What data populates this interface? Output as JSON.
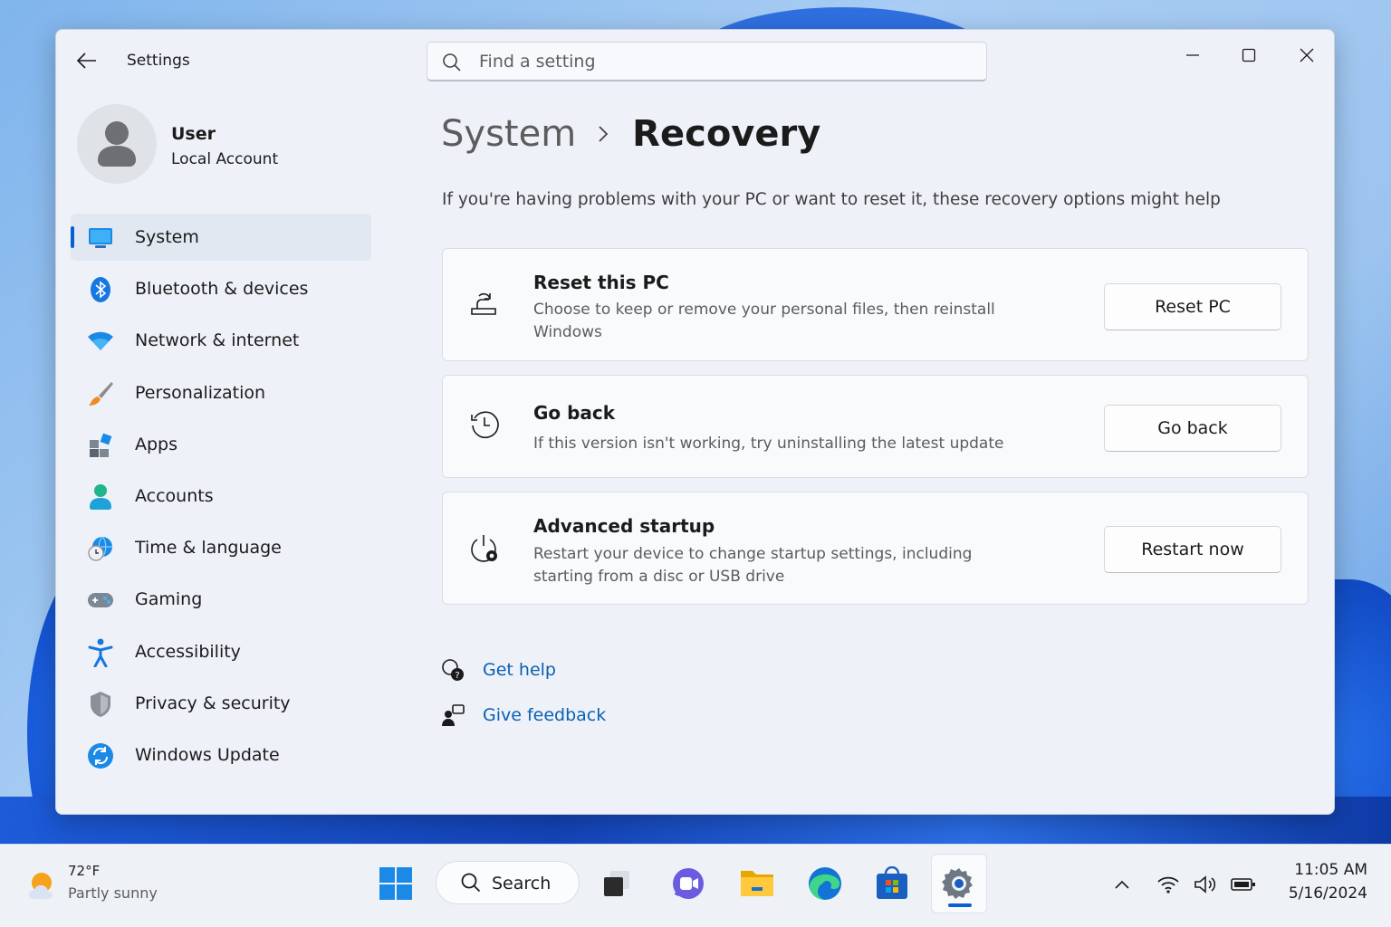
{
  "window": {
    "app_title": "Settings"
  },
  "search": {
    "placeholder": "Find a setting"
  },
  "profile": {
    "name": "User",
    "account_type": "Local Account"
  },
  "sidebar": {
    "items": [
      {
        "label": "System",
        "icon": "system-icon",
        "active": true
      },
      {
        "label": "Bluetooth & devices",
        "icon": "bluetooth-icon"
      },
      {
        "label": "Network & internet",
        "icon": "wifi-icon"
      },
      {
        "label": "Personalization",
        "icon": "brush-icon"
      },
      {
        "label": "Apps",
        "icon": "apps-icon"
      },
      {
        "label": "Accounts",
        "icon": "accounts-icon"
      },
      {
        "label": "Time & language",
        "icon": "globe-clock-icon"
      },
      {
        "label": "Gaming",
        "icon": "gamepad-icon"
      },
      {
        "label": "Accessibility",
        "icon": "accessibility-icon"
      },
      {
        "label": "Privacy & security",
        "icon": "shield-icon"
      },
      {
        "label": "Windows Update",
        "icon": "update-icon"
      }
    ]
  },
  "main": {
    "breadcrumb_parent": "System",
    "breadcrumb_current": "Recovery",
    "subtitle": "If you're having problems with your PC or want to reset it, these recovery options might help",
    "cards": [
      {
        "title": "Reset this PC",
        "description": "Choose to keep or remove your personal files, then reinstall Windows",
        "button": "Reset PC",
        "icon": "reset-pc-icon"
      },
      {
        "title": "Go back",
        "description": "If this version isn't working, try uninstalling the latest update",
        "button": "Go back",
        "icon": "history-icon"
      },
      {
        "title": "Advanced startup",
        "description": "Restart your device to change startup settings, including starting from a disc or USB drive",
        "button": "Restart now",
        "icon": "power-gear-icon"
      }
    ],
    "links": [
      {
        "label": "Get help",
        "icon": "help-icon"
      },
      {
        "label": "Give feedback",
        "icon": "feedback-icon"
      }
    ]
  },
  "taskbar": {
    "weather_temp": "72°F",
    "weather_condition": "Partly sunny",
    "search_label": "Search",
    "time": "11:05 AM",
    "date": "5/16/2024"
  },
  "colors": {
    "accent": "#0a5fd6",
    "link": "#0a5fb4",
    "window_bg": "#eef2f8"
  }
}
